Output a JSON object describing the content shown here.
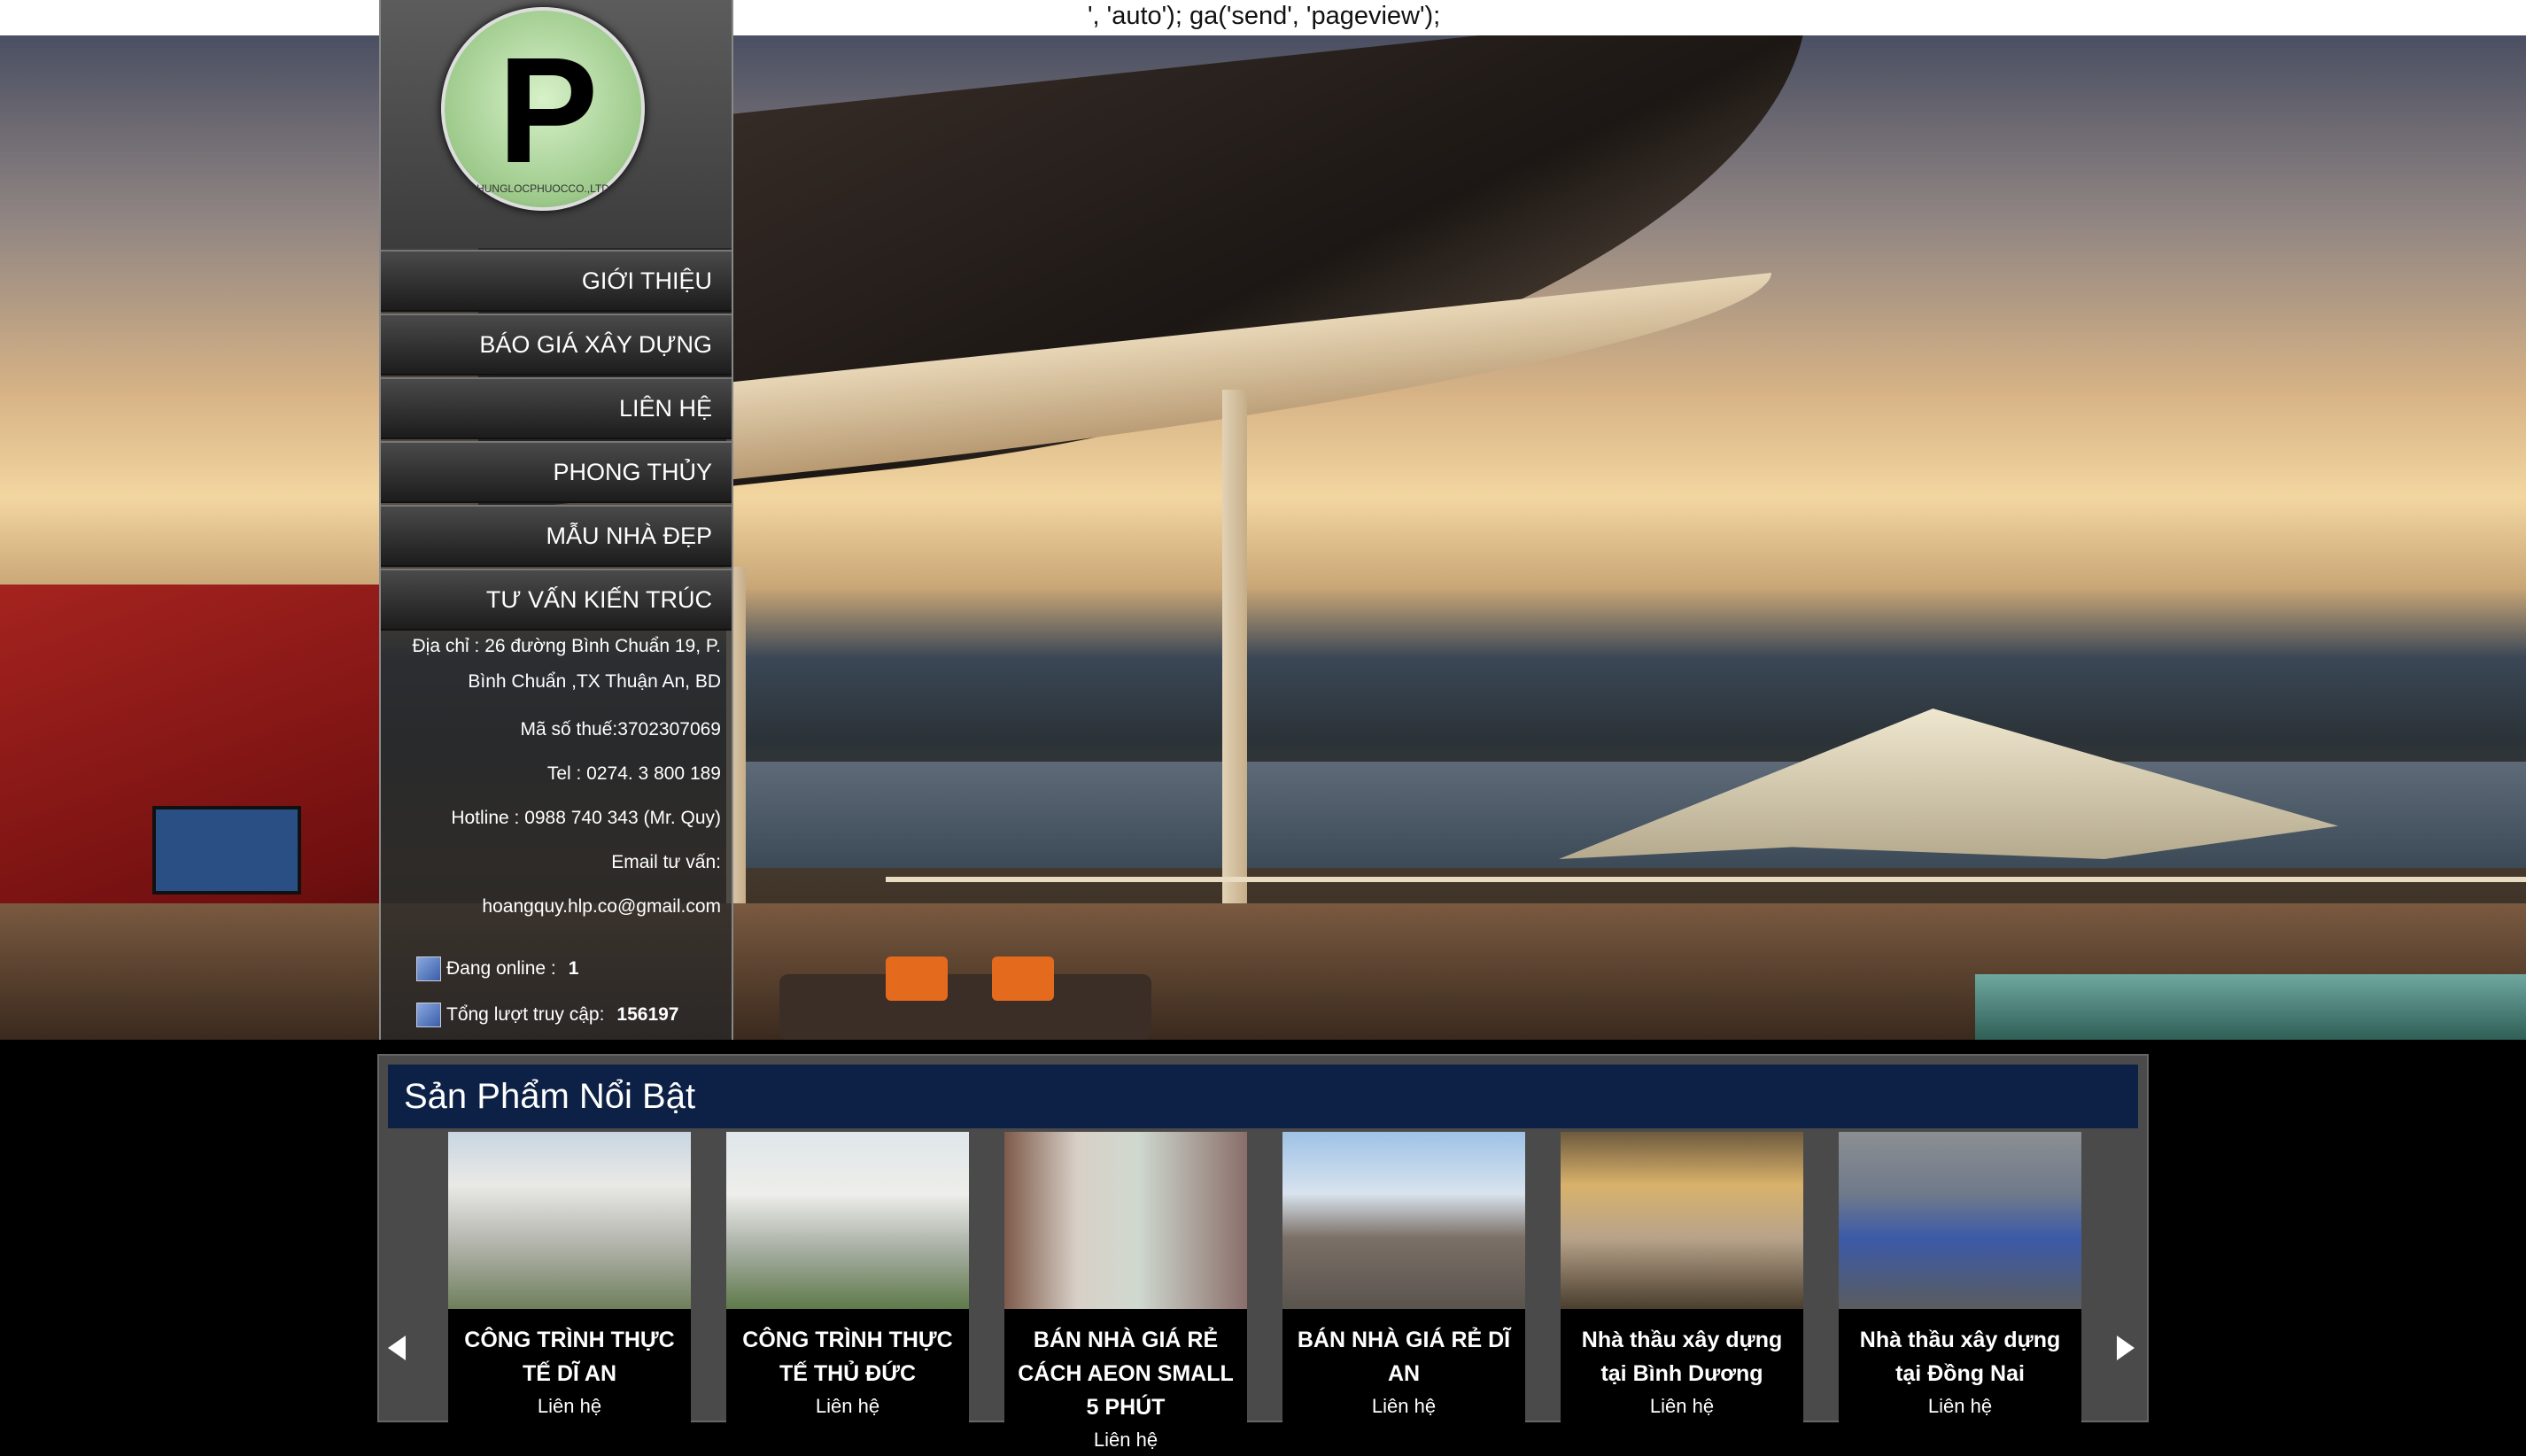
{
  "stray_script_text": "', 'auto'); ga('send', 'pageview');",
  "logo": {
    "letter": "P",
    "ring_text": "HUNGLOCPHUOCCO.,LTD"
  },
  "menu": [
    {
      "label": "GIỚI THIỆU"
    },
    {
      "label": "BÁO GIÁ XÂY DỰNG"
    },
    {
      "label": "LIÊN HỆ"
    },
    {
      "label": "PHONG THỦY"
    },
    {
      "label": "MẪU NHÀ ĐẸP"
    },
    {
      "label": "TƯ VẤN KIẾN TRÚC"
    }
  ],
  "contact": {
    "address_line1": "Địa chỉ : 26 đường Bình Chuẩn 19, P.",
    "address_line2": "Bình Chuẩn ,TX Thuận An, BD",
    "tax": "Mã số thuế:3702307069",
    "tel": "Tel : 0274. 3 800 189",
    "hotline": "Hotline : 0988 740 343 (Mr. Quy)",
    "email_label": "Email tư vấn:",
    "email": "hoangquy.hlp.co@gmail.com"
  },
  "stats": {
    "online_label": "Đang online :",
    "online_value": "1",
    "visits_label": "Tổng lượt truy cập:",
    "visits_value": "156197"
  },
  "featured": {
    "title": "Sản Phẩm Nổi Bật",
    "products": [
      {
        "title": "CÔNG TRÌNH THỰC TẾ DĨ AN",
        "more": "Liên hệ"
      },
      {
        "title": "CÔNG TRÌNH THỰC TẾ THỦ ĐỨC",
        "more": "Liên hệ"
      },
      {
        "title": "BÁN NHÀ GIÁ RẺ CÁCH AEON SMALL 5 PHÚT",
        "more": "Liên hệ"
      },
      {
        "title": "BÁN NHÀ GIÁ RẺ DĨ AN",
        "more": "Liên hệ"
      },
      {
        "title": "Nhà thầu xây dựng tại Bình Dương",
        "more": "Liên hệ"
      },
      {
        "title": "Nhà thầu xây dựng tại Đồng Nai",
        "more": "Liên hệ"
      }
    ]
  },
  "colors": {
    "header_bar": "#0d2147",
    "sidebar": "#2a2a2a",
    "background": "#000000"
  },
  "icons": {
    "prev": "arrow-left-icon",
    "next": "arrow-right-icon",
    "online": "user-online-icon",
    "visits": "stats-icon"
  }
}
